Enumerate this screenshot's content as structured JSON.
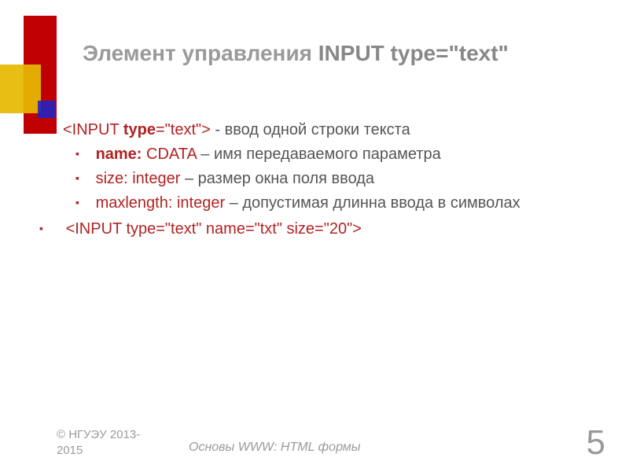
{
  "title": {
    "pre": "Элемент управления ",
    "bold": "INPUT type=\"text\""
  },
  "line1": {
    "tag_pre": "<INPUT ",
    "tag_kw": "type",
    "tag_post": "=\"text\">",
    "desc": "  - ввод одной строки текста"
  },
  "bullets": [
    {
      "attr": "name:",
      "val": " CDATA",
      "desc": " – имя передаваемого параметра",
      "bold": true
    },
    {
      "attr": "size: integer",
      "val": "",
      "desc": " – размер окна  поля ввода",
      "bold": false
    },
    {
      "attr": "maxlength: integer",
      "val": "",
      "desc": " – допустимая длинна ввода в символах",
      "bold": false
    }
  ],
  "example": "<INPUT type=\"text\" name=\"txt\" size=\"20\">",
  "footer": {
    "copyright_l1": "© НГУЭУ 2013-",
    "copyright_l2": "2015",
    "center": "Основы WWW: HTML формы",
    "page": "5"
  }
}
